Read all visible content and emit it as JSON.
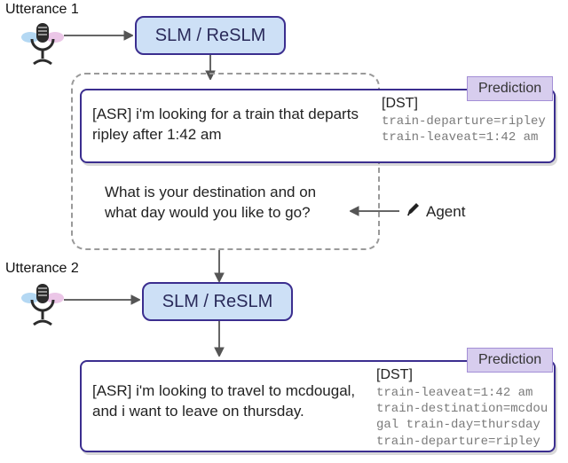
{
  "labels": {
    "utterance1": "Utterance 1",
    "utterance2": "Utterance 2",
    "slm": "SLM / ReSLM",
    "prediction": "Prediction",
    "dst": "[DST]",
    "agent": "Agent"
  },
  "turn1": {
    "asr": "[ASR] i'm looking for a train that departs ripley after 1:42 am",
    "dst": "train-departure=ripley\ntrain-leaveat=1:42 am"
  },
  "agent_prompt": "What is your destination and on what day would you like to go?",
  "turn2": {
    "asr": "[ASR] i'm looking to travel to mcdougal, and i want to leave on thursday.",
    "dst": "train-leaveat=1:42 am\ntrain-destination=mcdougal train-day=thursday\ntrain-departure=ripley"
  }
}
